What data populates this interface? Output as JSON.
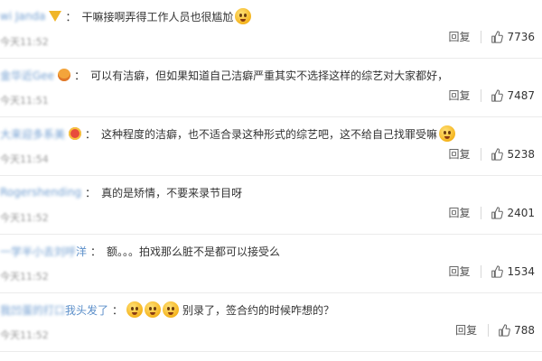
{
  "comments": [
    {
      "username": "wi Janda",
      "badge": "gold",
      "colon": "：",
      "text": "干嘛接啊弄得工作人员也很尴尬",
      "emoji_after": [
        "dizzy-face-emoji"
      ],
      "timestamp": "今天11:52",
      "reply_label": "回复",
      "likes": "7736"
    },
    {
      "username": "金华近Gee",
      "badge": "orange",
      "colon": "：",
      "text": "可以有洁癖，但如果知道自己洁癖严重其实不选择这样的综艺对大家都好，",
      "emoji_after": [],
      "timestamp": "今天11:51",
      "reply_label": "回复",
      "likes": "7487"
    },
    {
      "username": "大来迎多系美",
      "badge": "crown",
      "colon": "：",
      "text": "这种程度的洁癖，也不适合录这种形式的综艺吧，这不给自己找罪受嘛",
      "emoji_after": [
        "laughing-tears-emoji"
      ],
      "timestamp": "今天11:54",
      "reply_label": "回复",
      "likes": "5238"
    },
    {
      "username": "Rogershending",
      "badge": "none",
      "colon": "：",
      "text": "真的是矫情，不要来录节目呀",
      "emoji_after": [],
      "timestamp": "今天11:52",
      "reply_label": "回复",
      "likes": "2401"
    },
    {
      "username": "一学半小去刘呼",
      "username_tail": "洋",
      "badge": "none",
      "colon": "：",
      "text": "额。。。拍戏那么脏不是都可以接受么",
      "emoji_after": [],
      "timestamp": "今天11:52",
      "reply_label": "回复",
      "likes": "1534"
    },
    {
      "username": "我凹蛋的打口",
      "username_tail": "我头发了",
      "badge": "none",
      "colon": "：",
      "text": "别录了，签合约的时候咋想的？",
      "emoji_before": [
        "thinking-emoji",
        "thinking-emoji",
        "thinking-emoji"
      ],
      "emoji_after": [],
      "timestamp": "今天11:52",
      "reply_label": "回复",
      "likes": "788"
    }
  ],
  "colors": {
    "username": "#5a8ec9",
    "text": "#333333",
    "meta": "#999999",
    "divider": "#ebebeb"
  },
  "icons": {
    "like": "thumbs-up-icon"
  }
}
